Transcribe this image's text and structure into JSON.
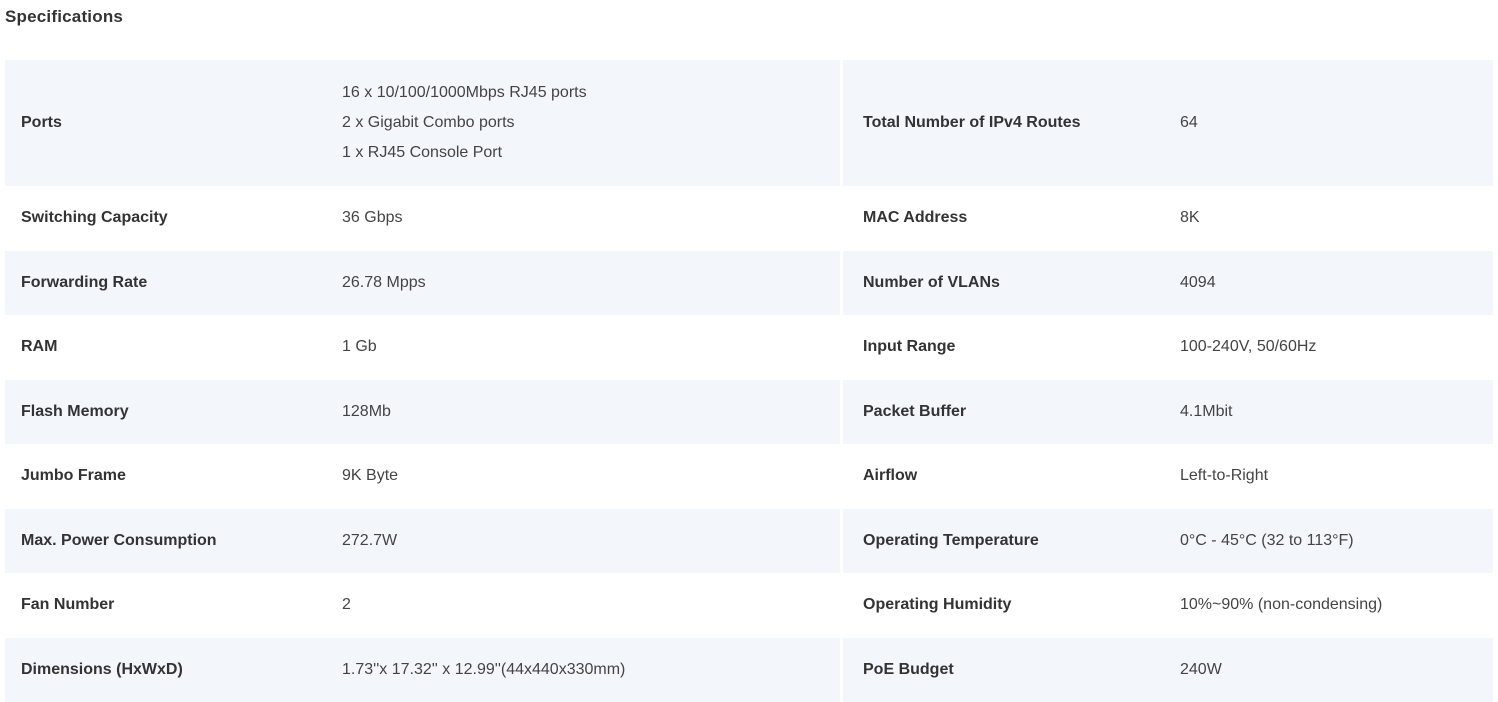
{
  "page": {
    "title": "Specifications"
  },
  "colors": {
    "shaded_row": "#f3f6fb",
    "plain_row": "#ffffff",
    "text": "#333333"
  },
  "specs": {
    "rows": [
      {
        "left": {
          "label": "Ports",
          "value_lines": [
            "16 x 10/100/1000Mbps RJ45 ports",
            "2 x Gigabit Combo ports",
            "1 x RJ45 Console Port"
          ]
        },
        "right": {
          "label": "Total Number of IPv4 Routes",
          "value": "64"
        }
      },
      {
        "left": {
          "label": "Switching Capacity",
          "value": "36 Gbps"
        },
        "right": {
          "label": "MAC Address",
          "value": "8K"
        }
      },
      {
        "left": {
          "label": "Forwarding Rate",
          "value": "26.78 Mpps"
        },
        "right": {
          "label": "Number of VLANs",
          "value": "4094"
        }
      },
      {
        "left": {
          "label": "RAM",
          "value": "1 Gb"
        },
        "right": {
          "label": "Input Range",
          "value": "100-240V, 50/60Hz"
        }
      },
      {
        "left": {
          "label": "Flash Memory",
          "value": "128Mb"
        },
        "right": {
          "label": "Packet Buffer",
          "value": "4.1Mbit"
        }
      },
      {
        "left": {
          "label": "Jumbo Frame",
          "value": "9K Byte"
        },
        "right": {
          "label": "Airflow",
          "value": "Left-to-Right"
        }
      },
      {
        "left": {
          "label": "Max. Power Consumption",
          "value": "272.7W"
        },
        "right": {
          "label": "Operating Temperature",
          "value": "0°C - 45°C (32 to 113°F)"
        }
      },
      {
        "left": {
          "label": "Fan Number",
          "value": "2"
        },
        "right": {
          "label": "Operating Humidity",
          "value": "10%~90% (non-condensing)"
        }
      },
      {
        "left": {
          "label": "Dimensions (HxWxD)",
          "value": "1.73''x 17.32'' x 12.99''(44x440x330mm)"
        },
        "right": {
          "label": "PoE Budget",
          "value": "240W"
        }
      }
    ]
  }
}
